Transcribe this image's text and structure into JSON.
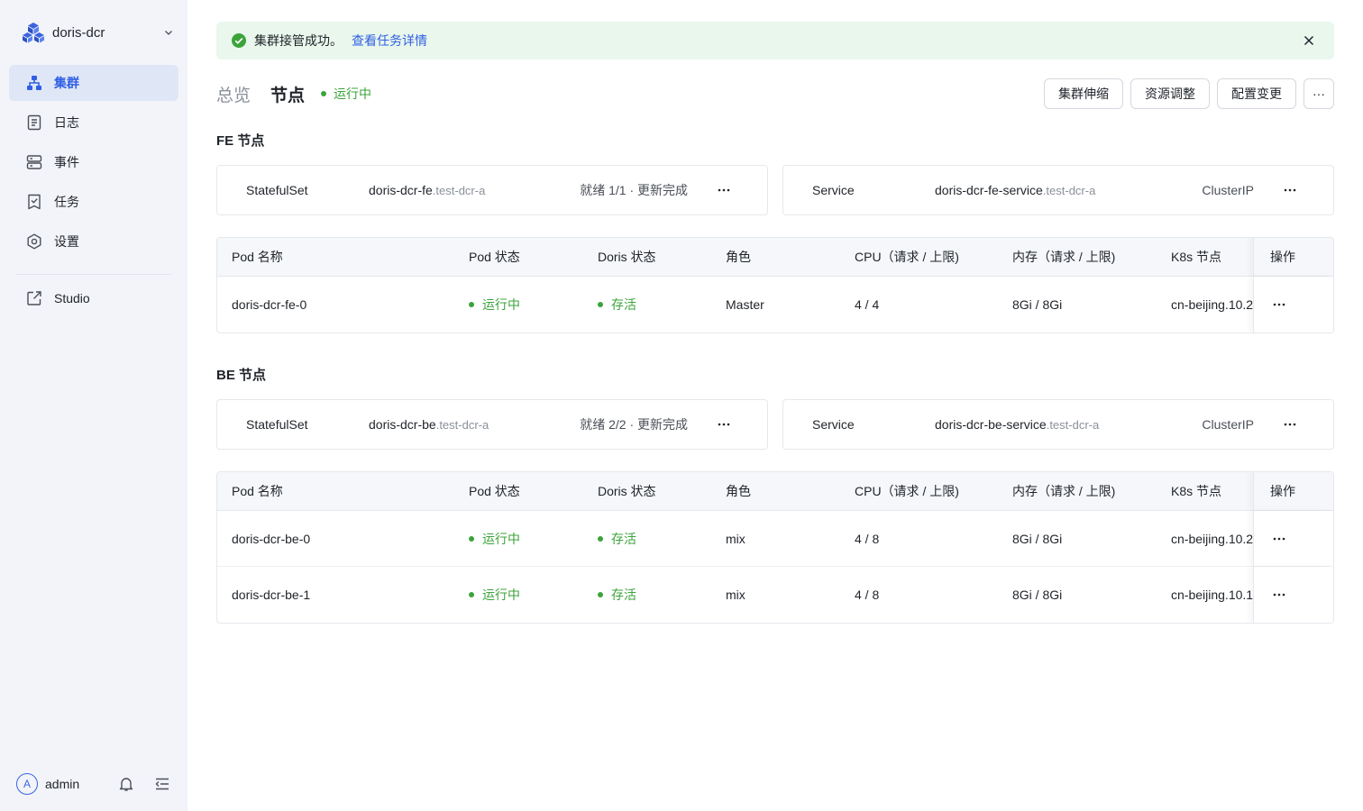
{
  "sidebar": {
    "cluster_name": "doris-dcr",
    "items": [
      {
        "label": "集群",
        "icon": "cluster-icon",
        "active": true
      },
      {
        "label": "日志",
        "icon": "log-icon"
      },
      {
        "label": "事件",
        "icon": "event-icon"
      },
      {
        "label": "任务",
        "icon": "task-icon"
      },
      {
        "label": "设置",
        "icon": "gear-icon"
      }
    ],
    "studio_label": "Studio",
    "user": {
      "avatar_letter": "A",
      "name": "admin"
    }
  },
  "alert": {
    "message": "集群接管成功。",
    "link": "查看任务详情"
  },
  "header": {
    "tabs": [
      "总览",
      "节点"
    ],
    "active_tab": "节点",
    "status": "运行中",
    "actions": [
      "集群伸缩",
      "资源调整",
      "配置变更"
    ],
    "more": "···"
  },
  "sections": [
    {
      "title": "FE 节点",
      "statefulset": {
        "label": "StatefulSet",
        "name": "doris-dcr-fe",
        "namespace": ".test-dcr-a",
        "status": "就绪 1/1 · 更新完成"
      },
      "service": {
        "label": "Service",
        "name": "doris-dcr-fe-service",
        "namespace": ".test-dcr-a",
        "type": "ClusterIP"
      },
      "columns": [
        "Pod 名称",
        "Pod 状态",
        "Doris 状态",
        "角色",
        "CPU（请求 / 上限)",
        "内存（请求 / 上限)",
        "K8s 节点",
        "操作"
      ],
      "rows": [
        {
          "name": "doris-dcr-fe-0",
          "pod_status": "运行中",
          "doris_status": "存活",
          "role": "Master",
          "cpu": "4 / 4",
          "mem": "8Gi / 8Gi",
          "node": "cn-beijing.10.2"
        }
      ]
    },
    {
      "title": "BE 节点",
      "statefulset": {
        "label": "StatefulSet",
        "name": "doris-dcr-be",
        "namespace": ".test-dcr-a",
        "status": "就绪 2/2 · 更新完成"
      },
      "service": {
        "label": "Service",
        "name": "doris-dcr-be-service",
        "namespace": ".test-dcr-a",
        "type": "ClusterIP"
      },
      "columns": [
        "Pod 名称",
        "Pod 状态",
        "Doris 状态",
        "角色",
        "CPU（请求 / 上限)",
        "内存（请求 / 上限)",
        "K8s 节点",
        "操作"
      ],
      "rows": [
        {
          "name": "doris-dcr-be-0",
          "pod_status": "运行中",
          "doris_status": "存活",
          "role": "mix",
          "cpu": "4 / 8",
          "mem": "8Gi / 8Gi",
          "node": "cn-beijing.10.2"
        },
        {
          "name": "doris-dcr-be-1",
          "pod_status": "运行中",
          "doris_status": "存活",
          "role": "mix",
          "cpu": "4 / 8",
          "mem": "8Gi / 8Gi",
          "node": "cn-beijing.10.1"
        }
      ]
    }
  ],
  "colors": {
    "accent": "#2f5fe3",
    "success": "#3ca33c",
    "sidebar_bg": "#f2f4f9",
    "alert_bg": "#e9f7ec"
  }
}
